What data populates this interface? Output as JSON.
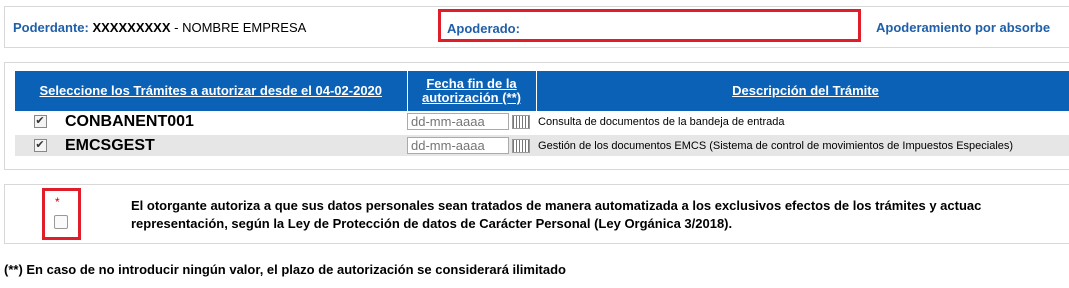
{
  "header": {
    "poderdante_label": "Poderdante:",
    "poderdante_nif": "XXXXXXXXX",
    "poderdante_name": " - NOMBRE EMPRESA",
    "apoderado_label": "Apoderado:",
    "absorbe_label": "Apoderamiento por absorbe"
  },
  "table": {
    "columns": {
      "tramites": "Seleccione los Trámites a autorizar desde el 04-02-2020",
      "fecha_fin": "Fecha fin de la autorización (**)",
      "descripcion": "Descripción del Trámite"
    },
    "rows": [
      {
        "checked": true,
        "check_glyph": "✔",
        "code": "CONBANENT001",
        "date_placeholder": "dd-mm-aaaa",
        "description": "Consulta de documentos de la bandeja de entrada"
      },
      {
        "checked": true,
        "check_glyph": "✔",
        "code": "EMCSGEST",
        "date_placeholder": "dd-mm-aaaa",
        "description": "Gestión de los documentos EMCS (Sistema de control de movimientos de Impuestos Especiales)"
      }
    ]
  },
  "consent": {
    "required_mark": "*",
    "checked": false,
    "line1": "El otorgante autoriza a que sus datos personales sean tratados de manera automatizada a los exclusivos efectos de los trámites y actuac",
    "line2": "representación, según la Ley de Protección de datos de Carácter Personal (Ley Orgánica 3/2018)."
  },
  "footnote": "(**) En caso de no introducir ningún valor, el plazo de autorización se considerará ilimitado",
  "colors": {
    "header_blue": "#0b61b6",
    "label_blue": "#1f5fa8",
    "highlight_red": "#e01e2a",
    "row_alt": "#e6e6e6"
  }
}
